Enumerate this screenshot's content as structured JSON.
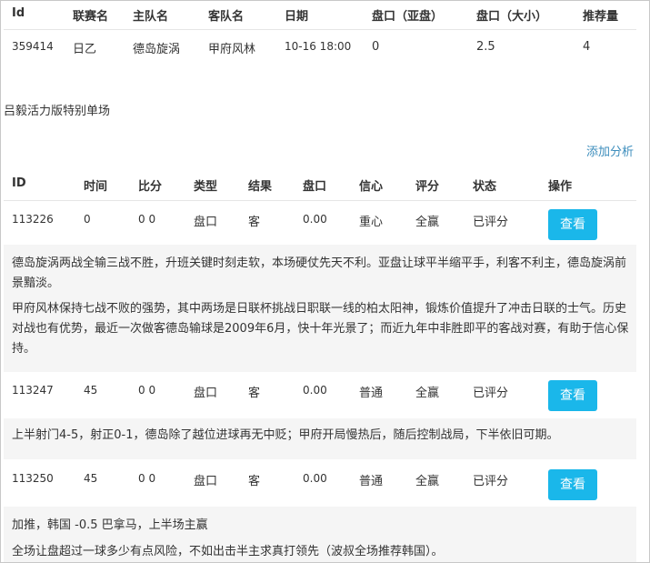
{
  "match_table": {
    "headers": [
      "Id",
      "联赛名",
      "主队名",
      "客队名",
      "日期",
      "盘口（亚盘）",
      "盘口（大小）",
      "推荐量"
    ],
    "row": [
      "359414",
      "日乙",
      "德岛旋涡",
      "甲府风林",
      "10-16 18:00",
      "0",
      "2.5",
      "4"
    ]
  },
  "special_title": "吕毅活力版特别单场",
  "add_analysis_label": "添加分析",
  "analysis_table": {
    "headers": [
      "ID",
      "时间",
      "比分",
      "类型",
      "结果",
      "盘口",
      "信心",
      "评分",
      "状态",
      "操作"
    ],
    "rows": [
      {
        "cells": [
          "113226",
          "0",
          "0 0",
          "盘口",
          "客",
          "0.00",
          "重心",
          "全赢",
          "已评分"
        ],
        "button": "查看",
        "paragraphs": [
          "德岛旋涡两战全输三战不胜，升班关键时刻走软，本场硬仗先天不利。亚盘让球平半缩平手，利客不利主，德岛旋涡前景黯淡。",
          "甲府风林保持七战不败的强势，其中两场是日联杯挑战日职联一线的柏太阳神，锻炼价值提升了冲击日联的士气。历史对战也有优势，最近一次做客德岛输球是2009年6月，快十年光景了；而近九年中非胜即平的客战对赛，有助于信心保持。"
        ]
      },
      {
        "cells": [
          "113247",
          "45",
          "0 0",
          "盘口",
          "客",
          "0.00",
          "普通",
          "全赢",
          "已评分"
        ],
        "button": "查看",
        "paragraphs": [
          "上半射门4-5，射正0-1，德岛除了越位进球再无中贬；甲府开局慢热后，随后控制战局，下半依旧可期。"
        ]
      },
      {
        "cells": [
          "113250",
          "45",
          "0 0",
          "盘口",
          "客",
          "0.00",
          "普通",
          "全赢",
          "已评分"
        ],
        "button": "查看",
        "paragraphs": [
          "加推，韩国 -0.5 巴拿马，上半场主赢",
          "全场让盘超过一球多少有点风险，不如出击半主求真打领先（波叔全场推荐韩国）。"
        ]
      }
    ]
  }
}
